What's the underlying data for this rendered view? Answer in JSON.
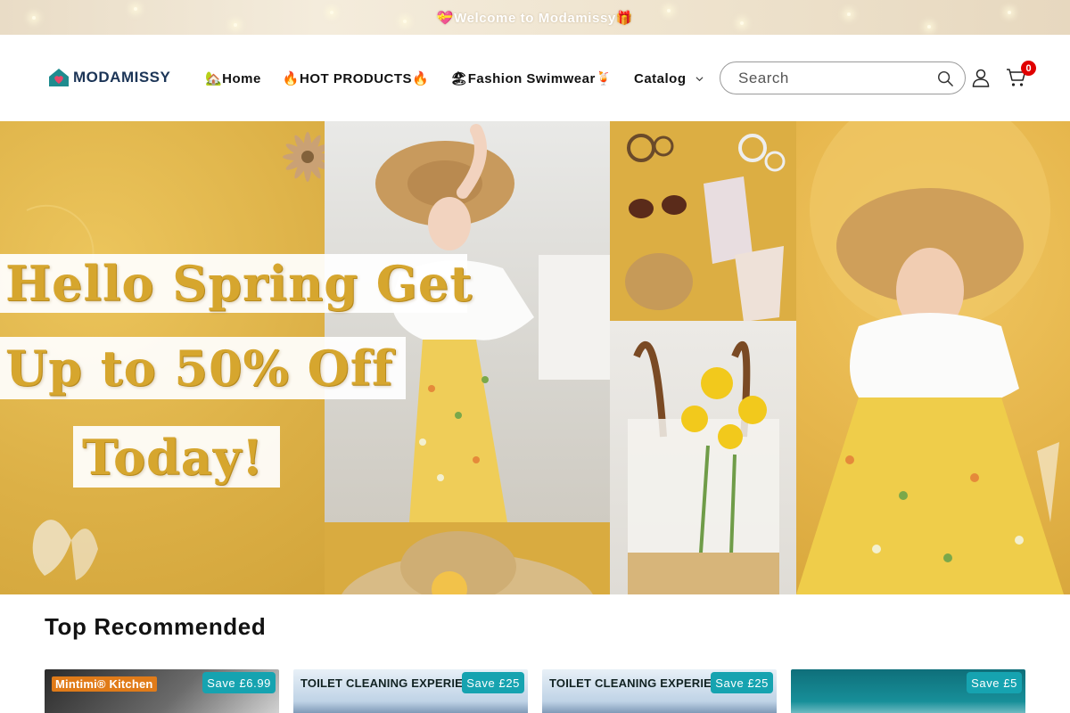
{
  "announcement": {
    "text": "💝Welcome to Modamissy🎁"
  },
  "header": {
    "logo_text": "MODAMISSY",
    "nav": [
      {
        "label": "🏡Home"
      },
      {
        "label": "🔥HOT PRODUCTS🔥"
      },
      {
        "label": "🏖Fashion Swimwear🍹"
      },
      {
        "label": "Catalog"
      }
    ],
    "search": {
      "placeholder": "Search"
    },
    "cart_count": "0"
  },
  "hero": {
    "lines": [
      "Hello Spring Get",
      "Up to 50% Off",
      "Today!"
    ]
  },
  "section": {
    "title": "Top Recommended"
  },
  "products": [
    {
      "badge": "Save £6.99",
      "caption": "Mintimi® Kitchen"
    },
    {
      "badge": "Save £25",
      "caption": "TOILET CLEANING EXPERIEN"
    },
    {
      "badge": "Save £25",
      "caption": "TOILET CLEANING EXPERIEN"
    },
    {
      "badge": "Save £5",
      "caption": ""
    }
  ],
  "colors": {
    "badge": "#16a3b0",
    "cart_count": "#e00000",
    "logo": "#1c3557",
    "promo_text": "#d6a62e"
  }
}
